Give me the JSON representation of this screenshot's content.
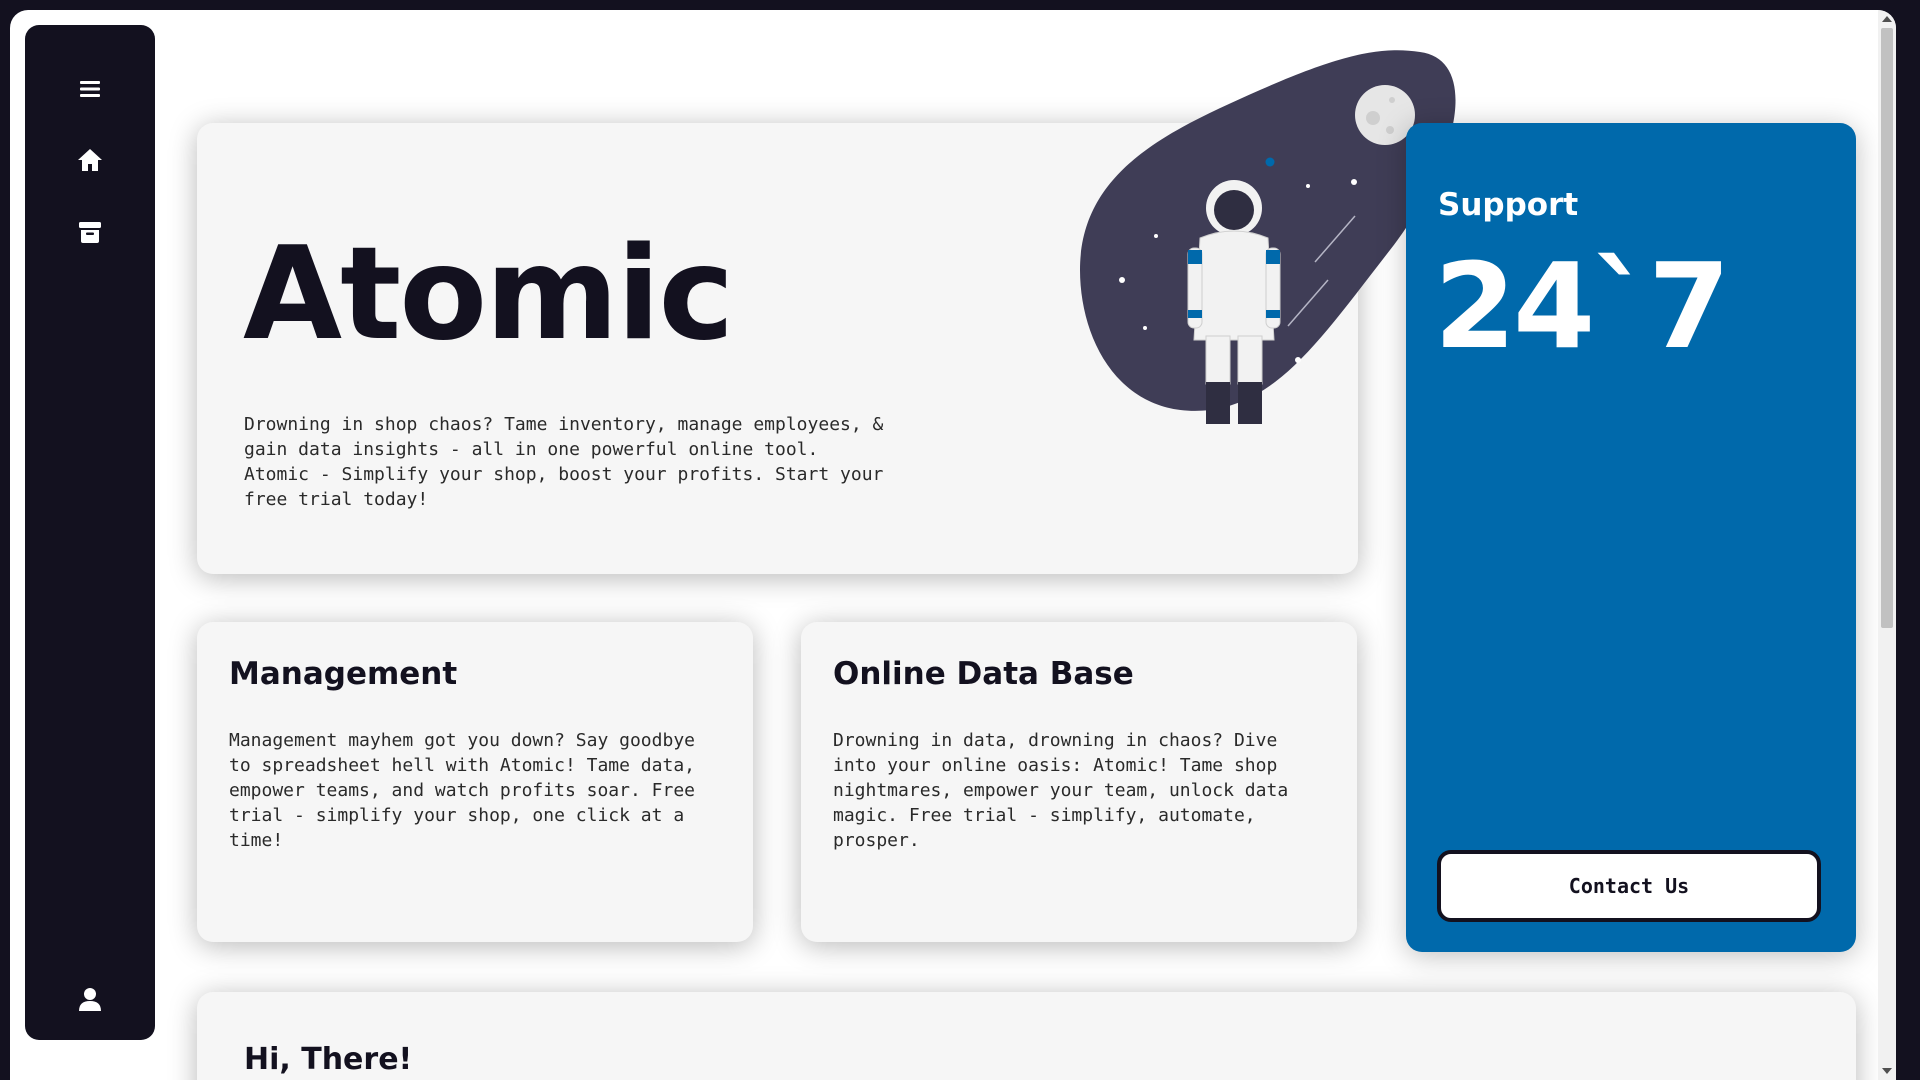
{
  "sidebar": {
    "icons": [
      "menu-icon",
      "home-icon",
      "archive-icon",
      "user-icon"
    ]
  },
  "hero": {
    "title": "Atomic",
    "text": "Drowning in shop chaos? Tame inventory, manage employees, & gain data insights - all in one powerful online tool. Atomic - Simplify your shop, boost your profits. Start your free trial today!"
  },
  "support": {
    "title": "Support",
    "value": "24`7",
    "button_label": "Contact Us"
  },
  "features": [
    {
      "title": "Management",
      "text": "Management mayhem got you down? Say goodbye to spreadsheet hell with Atomic! Tame data, empower teams, and watch profits soar. Free trial - simplify your shop, one click at a time!"
    },
    {
      "title": "Online Data Base",
      "text": "Drowning in data, drowning in chaos? Dive into your online oasis: Atomic! Tame shop nightmares, empower your team, unlock data magic. Free trial - simplify, automate, prosper."
    }
  ],
  "greeting": {
    "title": "Hi, There!"
  },
  "colors": {
    "dark": "#13111f",
    "accent_blue": "#0069ab",
    "card_bg": "#f6f6f6"
  }
}
